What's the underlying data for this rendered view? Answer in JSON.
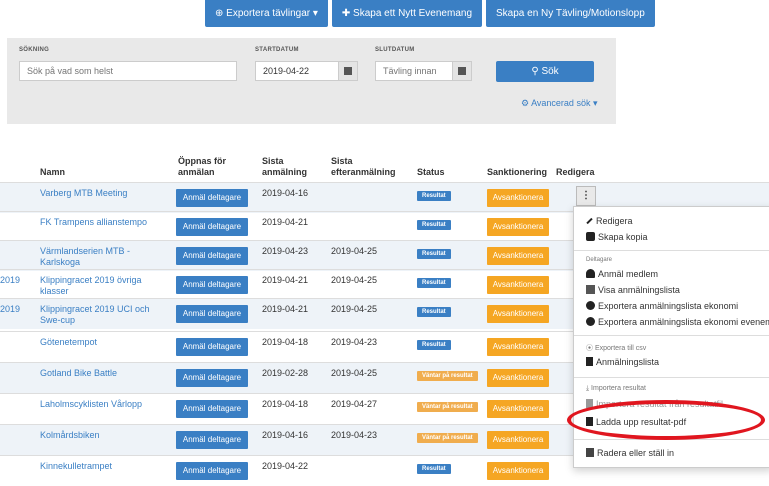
{
  "toolbar": {
    "export_label": "⊕ Exportera tävlingar ▾",
    "new_event_label": "✚ Skapa ett Nytt Evenemang",
    "new_race_label": "Skapa en Ny Tävling/Motionslopp"
  },
  "search": {
    "label": "SÖKNING",
    "placeholder": "Sök på vad som helst",
    "start_label": "STARTDATUM",
    "start_value": "2019-04-22",
    "end_label": "SLUTDATUM",
    "end_placeholder": "Tävling innan",
    "button_label": "Sök",
    "advanced_label": "Avancerad sök ▾"
  },
  "table": {
    "headers": {
      "name": "Namn",
      "opens": "Öppnas för anmälan",
      "last": "Sista anmälning",
      "late": "Sista efteranmälning",
      "status": "Status",
      "sanction": "Sanktionering",
      "edit": "Redigera"
    },
    "register_label": "Anmäl deltagare",
    "sanction_label": "Avsanktionera",
    "rows": [
      {
        "year": "",
        "name": "Varberg MTB Meeting",
        "last": "2019-04-16",
        "late": "",
        "status": "Resultat",
        "status_type": "ok"
      },
      {
        "year": "",
        "name": "FK Trampens allianstempo",
        "last": "2019-04-21",
        "late": "",
        "status": "Resultat",
        "status_type": "ok"
      },
      {
        "year": "",
        "name": "Värmlandserien MTB - Karlskoga",
        "last": "2019-04-23",
        "late": "2019-04-25",
        "status": "Resultat",
        "status_type": "ok"
      },
      {
        "year": "2019",
        "name": "Klippingracet 2019 övriga klasser",
        "last": "2019-04-21",
        "late": "2019-04-25",
        "status": "Resultat",
        "status_type": "ok"
      },
      {
        "year": "2019",
        "name": "Klippingracet 2019 UCI och Swe-cup",
        "last": "2019-04-21",
        "late": "2019-04-25",
        "status": "Resultat",
        "status_type": "ok"
      },
      {
        "year": "",
        "name": "Götenetempot",
        "last": "2019-04-18",
        "late": "2019-04-23",
        "status": "Resultat",
        "status_type": "ok"
      },
      {
        "year": "",
        "name": "Gotland Bike Battle",
        "last": "2019-02-28",
        "late": "2019-04-25",
        "status": "Väntar på resultat",
        "status_type": "wait"
      },
      {
        "year": "",
        "name": "Laholmscyklisten Vårlopp",
        "last": "2019-04-18",
        "late": "2019-04-27",
        "status": "Väntar på resultat",
        "status_type": "wait"
      },
      {
        "year": "",
        "name": "Kolmårdsbiken",
        "last": "2019-04-16",
        "late": "2019-04-23",
        "status": "Väntar på resultat",
        "status_type": "wait"
      },
      {
        "year": "",
        "name": "Kinnekulletrampet",
        "last": "2019-04-22",
        "late": "",
        "status": "Resultat",
        "status_type": "ok"
      }
    ]
  },
  "menu": {
    "kebab": "⋮",
    "edit": "Redigera",
    "copy": "Skapa kopia",
    "participants_header": "Deltagare",
    "register_member": "Anmäl medlem",
    "show_list": "Visa anmälningslista",
    "export_economy": "Exportera anmälningslista ekonomi",
    "export_economy_event": "Exportera anmälningslista ekonomi evenemang",
    "export_csv_header": "Exportera till csv",
    "registration_list": "Anmälningslista",
    "import_header": "Importera resultat",
    "upload_file": "Importera resultat från resultatfil",
    "upload_pdf": "Ladda upp resultat-pdf",
    "delete": "Radera eller ställ in"
  },
  "colors": {
    "primary": "#3a7fc4",
    "warning": "#f5a623",
    "highlight": "#e0161f"
  }
}
